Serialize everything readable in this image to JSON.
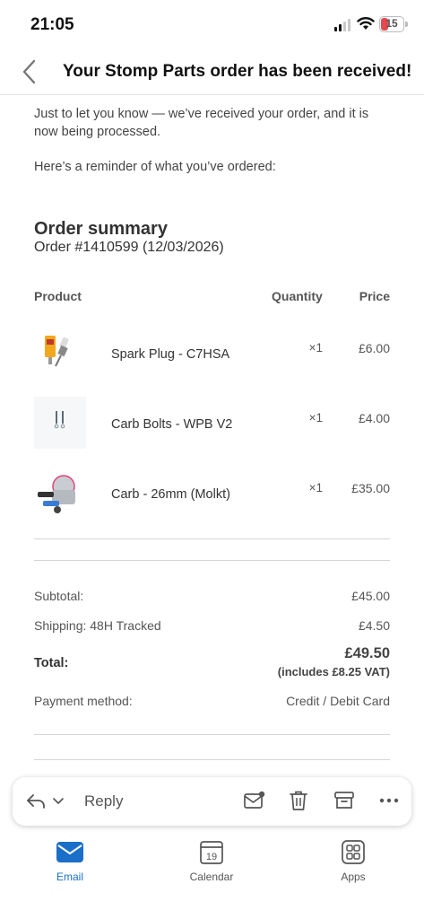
{
  "status_bar": {
    "time": "21:05",
    "battery": "15"
  },
  "header": {
    "title": "Your Stomp Parts order has been received!"
  },
  "email": {
    "intro_1": "Just to let you know — we’ve received your order, and it is now being processed.",
    "intro_2": "Here’s a reminder of what you’ve ordered:",
    "order_summary_title": "Order summary",
    "order_number": "Order #1410599 (12/03/2026)",
    "columns": {
      "product": "Product",
      "quantity": "Quantity",
      "price": "Price"
    },
    "items": [
      {
        "name": "Spark Plug - C7HSA",
        "qty": "×1",
        "price": "£6.00",
        "image_icon": "spark-plug-image"
      },
      {
        "name": "Carb Bolts - WPB V2",
        "qty": "×1",
        "price": "£4.00",
        "image_icon": "carb-bolts-image"
      },
      {
        "name": "Carb - 26mm (Molkt)",
        "qty": "×1",
        "price": "£35.00",
        "image_icon": "carburettor-image"
      }
    ],
    "subtotal_label": "Subtotal:",
    "subtotal_value": "£45.00",
    "shipping_label": "Shipping: 48H Tracked",
    "shipping_value": "£4.50",
    "total_label": "Total:",
    "total_value": "£49.50",
    "total_vat": "(includes £8.25 VAT)",
    "payment_label": "Payment method:",
    "payment_value": "Credit / Debit Card"
  },
  "action_bar": {
    "reply_label": "Reply"
  },
  "tabs": [
    {
      "label": "Email",
      "icon": "envelope-icon",
      "active": true
    },
    {
      "label": "Calendar",
      "icon": "calendar-icon",
      "day": "19"
    },
    {
      "label": "Apps",
      "icon": "apps-grid-icon"
    }
  ],
  "colors": {
    "accent": "#1a6fc8",
    "battery_low": "#e5484d"
  }
}
